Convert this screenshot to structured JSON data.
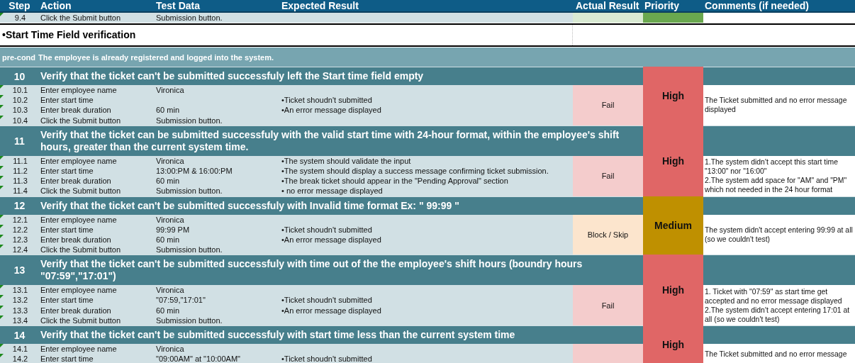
{
  "columns": [
    "Step",
    "Action",
    "Test Data",
    "Expected Result",
    "Actual Result",
    "Priority",
    "Comments (if needed)"
  ],
  "previous_step": {
    "step": "9.4",
    "action": "Click the Submit button",
    "test_data": "Submission button.",
    "actual_result": {
      "color": "#d9ead3"
    },
    "priority": {
      "color": "#6aa84f"
    }
  },
  "section": {
    "title": "•Start Time Field verification"
  },
  "precondition": {
    "label": "pre-cond",
    "text": "The employee is already registered and logged into the system."
  },
  "tests": [
    {
      "number": "10",
      "title": "Verify that the ticket can't  be submitted successfuly left the Start time field empty",
      "actual_result": {
        "text": "Fail",
        "color": "#f4cccc"
      },
      "priority": {
        "text": "High",
        "color": "#e06666"
      },
      "comments": [
        "The Ticket submitted and no error message displayed"
      ],
      "steps": [
        {
          "step": "10.1",
          "action": "Enter employee name",
          "test_data": "Vironica"
        },
        {
          "step": "10.2",
          "action": "Enter start time",
          "expected": "•Ticket shoudn't submitted"
        },
        {
          "step": "10.3",
          "action": "Enter break duration",
          "test_data": "60 min",
          "expected": "•An error message displayed"
        },
        {
          "step": "10.4",
          "action": "Click the Submit button",
          "test_data": "Submission button."
        }
      ]
    },
    {
      "number": "11",
      "title": "Verify that the ticket can  be submitted successfuly with the valid start time with 24-hour format, within the employee's shift hours, greater than the current system time.",
      "actual_result": {
        "text": "Fail",
        "color": "#f4cccc"
      },
      "priority": {
        "text": "High",
        "color": "#e06666"
      },
      "comments": [
        "1.The system didn't accept this start time \"13:00\" nor \"16:00\"",
        "2.The system add space for \"AM\" and \"PM\" which not needed in the 24 hour format"
      ],
      "steps": [
        {
          "step": "11.1",
          "action": "Enter employee name",
          "test_data": "Vironica",
          "expected": "•The system should validate the input"
        },
        {
          "step": "11.2",
          "action": "Enter start time",
          "test_data": "13:00:PM & 16:00:PM",
          "expected": "•The system should display a success message confirming ticket submission."
        },
        {
          "step": "11.3",
          "action": "Enter break duration",
          "test_data": "60 min",
          "expected": "•The break ticket should appear in the \"Pending Approval\" section"
        },
        {
          "step": "11.4",
          "action": "Click the Submit button",
          "test_data": "Submission button.",
          "expected": "• no error message displayed"
        }
      ]
    },
    {
      "number": "12",
      "title": "Verify that the ticket can't be submitted successfuly with Invalid time format  Ex: \" 99:99 \"",
      "actual_result": {
        "text": "Block / Skip",
        "color": "#fce5cd"
      },
      "priority": {
        "text": "Medium",
        "color": "#bf9000"
      },
      "comments": [
        "The system didn't accept entering 99:99 at all (so we couldn't test)"
      ],
      "steps": [
        {
          "step": "12.1",
          "action": "Enter employee name",
          "test_data": "Vironica"
        },
        {
          "step": "12.2",
          "action": "Enter start time",
          "test_data": "99:99 PM",
          "expected": "•Ticket shoudn't submitted"
        },
        {
          "step": "12.3",
          "action": "Enter break duration",
          "test_data": "60 min",
          "expected": "•An error message displayed"
        },
        {
          "step": "12.4",
          "action": "Click the Submit button",
          "test_data": "Submission button."
        }
      ]
    },
    {
      "number": "13",
      "title": "Verify that the ticket can't be submitted successfuly with time out of the the employee's shift hours (boundry hours \"07:59\",\"17:01\")",
      "actual_result": {
        "text": "Fail",
        "color": "#f4cccc"
      },
      "priority": {
        "text": "High",
        "color": "#e06666"
      },
      "comments": [
        "1. Ticket with \"07:59\" as start time get accepted and no error message displayed",
        "2.The system didn't accept entering 17:01 at all (so we couldn't test)"
      ],
      "steps": [
        {
          "step": "13.1",
          "action": "Enter employee name",
          "test_data": "Vironica"
        },
        {
          "step": "13.2",
          "action": "Enter start time",
          "test_data": "\"07:59,\"17:01\"",
          "expected": "•Ticket shoudn't submitted"
        },
        {
          "step": "13.3",
          "action": "Enter break duration",
          "test_data": "60 min",
          "expected": "•An error message displayed"
        },
        {
          "step": "13.4",
          "action": "Click the Submit button",
          "test_data": "Submission button."
        }
      ]
    },
    {
      "number": "14",
      "title": "Verify that the ticket can't be submitted successfuly with start time less than the current system time",
      "actual_result": {
        "color": "#f4cccc"
      },
      "priority": {
        "text": "High",
        "color": "#e06666"
      },
      "comments": [
        "The Ticket submitted and no error message"
      ],
      "steps": [
        {
          "step": "14.1",
          "action": "Enter employee name",
          "test_data": "Vironica"
        },
        {
          "step": "14.2",
          "action": "Enter start time",
          "test_data": "\"09:00AM\" at \"10:00AM\"",
          "expected": "•Ticket shoudn't submitted"
        }
      ]
    }
  ]
}
